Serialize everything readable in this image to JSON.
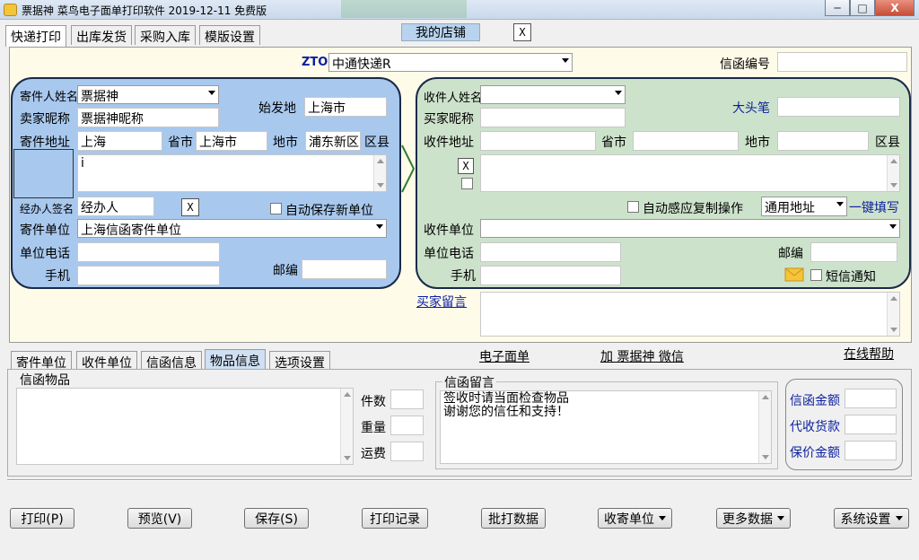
{
  "window": {
    "title": "票据神 菜鸟电子面单打印软件 2019-12-11 免费版",
    "min": "─",
    "max": "□",
    "close": "X"
  },
  "main_tabs": [
    "快递打印",
    "出库发货",
    "采购入库",
    "模版设置"
  ],
  "my_shop": "我的店铺",
  "x": "X",
  "carrier": {
    "code": "ZTO",
    "value": "中通快递R"
  },
  "letter_no_label": "信函编号",
  "sender": {
    "name_label": "寄件人姓名",
    "name": "票据神",
    "nick_label": "卖家昵称",
    "nick": "票据神昵称",
    "origin_label": "始发地",
    "origin": "上海市",
    "addr_label": "寄件地址",
    "province": "上海",
    "city_label": "省市",
    "city": "上海市",
    "district_label": "地市",
    "district": "浦东新区",
    "county_label": "区县",
    "addr_detail": "i",
    "handler_label": "经办人签名",
    "handler": "经办人",
    "autosave_label": "自动保存新单位",
    "unit_label": "寄件单位",
    "unit": "上海信函寄件单位",
    "phone_label": "单位电话",
    "mobile_label": "手机",
    "zip_label": "邮编"
  },
  "receiver": {
    "name_label": "收件人姓名",
    "nick_label": "买家昵称",
    "bighead_label": "大头笔",
    "addr_label": "收件地址",
    "province_label": "省市",
    "district_label": "地市",
    "county_label": "区县",
    "autocopy_label": "自动感应复制操作",
    "addr_type": "通用地址",
    "onekey": "一键填写",
    "unit_label": "收件单位",
    "phone_label": "单位电话",
    "zip_label": "邮编",
    "mobile_label": "手机",
    "sms_label": "短信通知"
  },
  "buyer_msg_label": "买家留言",
  "lower_tabs": [
    "寄件单位",
    "收件单位",
    "信函信息",
    "物品信息",
    "选项设置"
  ],
  "links": {
    "esheet": "电子面单",
    "wechat": "加 票据神 微信",
    "help": "在线帮助"
  },
  "goods": {
    "label": "信函物品",
    "count_label": "件数",
    "weight_label": "重量",
    "freight_label": "运费"
  },
  "message": {
    "label": "信函留言",
    "line1": "签收时请当面检查物品",
    "line2": "谢谢您的信任和支持！"
  },
  "amounts": {
    "letter": "信函金额",
    "cod": "代收货款",
    "insured": "保价金额"
  },
  "buttons": {
    "print": "打印(P)",
    "preview": "预览(V)",
    "save": "保存(S)",
    "records": "打印记录",
    "batch": "批打数据",
    "senders": "收寄单位",
    "more": "更多数据",
    "settings": "系统设置"
  }
}
